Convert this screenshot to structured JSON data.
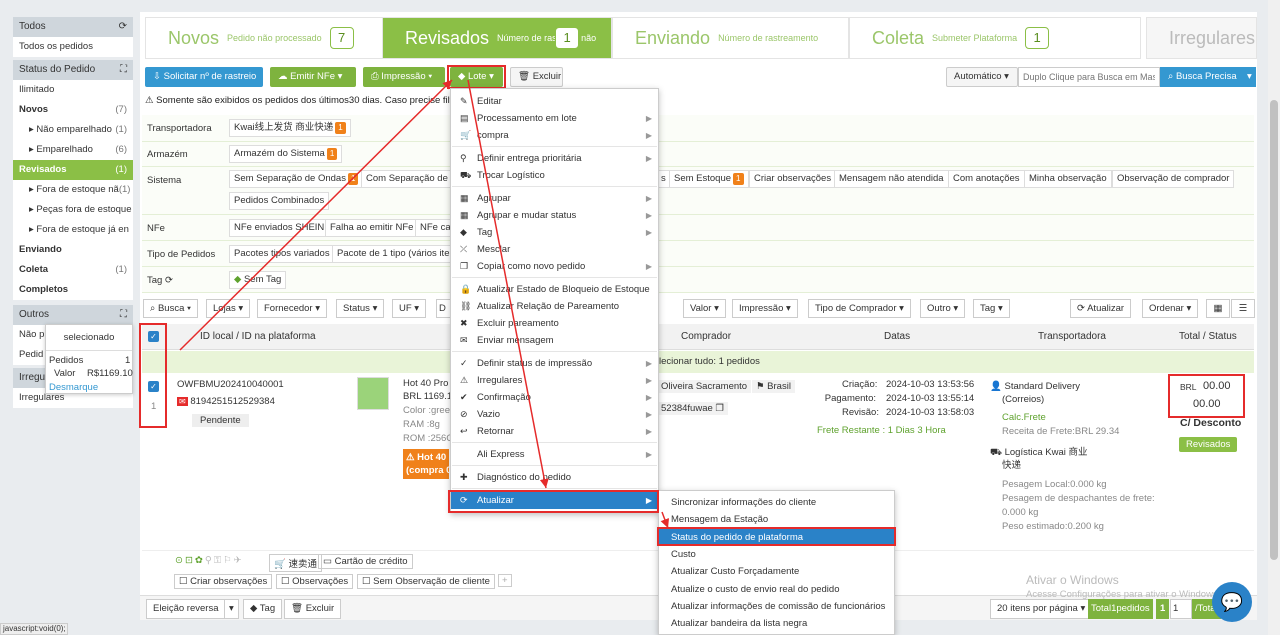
{
  "sidebar": {
    "todos_head": "Todos",
    "todos_item": "Todos os pedidos",
    "status_head": "Status do Pedido",
    "items": [
      {
        "label": "Ilimitado",
        "count": ""
      },
      {
        "label": "Novos",
        "count": "(7)"
      },
      {
        "label": "Não emparelhado",
        "count": "(1)"
      },
      {
        "label": "Emparelhado",
        "count": "(6)"
      },
      {
        "label": "Revisados",
        "count": "(1)"
      },
      {
        "label": "Fora de estoque nã",
        "count": "(1)"
      },
      {
        "label": "Peças fora de estoque",
        "count": ""
      },
      {
        "label": "Fora de estoque já en",
        "count": ""
      },
      {
        "label": "Enviando",
        "count": ""
      },
      {
        "label": "Coleta",
        "count": "(1)"
      },
      {
        "label": "Completos",
        "count": ""
      }
    ],
    "outros_head": "Outros",
    "outros_items": [
      "Não p",
      "Pedid"
    ],
    "irreg_head": "Irregu",
    "irreg_item": "Irregulares"
  },
  "popover": {
    "title": "selecionado",
    "pedidos_label": "Pedidos",
    "pedidos_val": "1",
    "valor_label": "Valor",
    "valor_val": "R$1169.10",
    "desmarque": "Desmarque"
  },
  "steps": [
    {
      "title": "Novos",
      "sub": "Pedido não processado",
      "count": "7"
    },
    {
      "title": "Revisados",
      "sub": "Número de rastre",
      "count": "1",
      "tail": "não"
    },
    {
      "title": "Enviando",
      "sub": "Número de rastreamento"
    },
    {
      "title": "Coleta",
      "sub": "Submeter Plataforma",
      "count": "1"
    },
    {
      "title": "Irregulares"
    }
  ],
  "toolbar": {
    "solicitar": "Solicitar nº de rastreio",
    "emitir": "Emitir NFe",
    "impressao": "Impressão",
    "lote": "Lote",
    "excluir": "Excluir",
    "automatico": "Automático",
    "search_placeholder": "Duplo Clique para Busca em Mass",
    "busca_precisa": "Busca Precisa"
  },
  "notice": "Somente são exibidos os pedidos dos últimos30 dias. Caso precise filtr",
  "filters": {
    "transportadora_label": "Transportadora",
    "transportadora_chip": "Kwai线上发货 商业快递",
    "transportadora_badge": "1",
    "armazem_label": "Armazém",
    "armazem_chip": "Armazém do Sistema",
    "armazem_badge": "1",
    "sistema_label": "Sistema",
    "sistema_chips": [
      "Sem Separação de Ondas",
      "Com Separação de O",
      "s",
      "Sem Estoque",
      "Criar observações",
      "Mensagem não atendida",
      "Com anotações",
      "Minha observação",
      "Observação de comprador",
      "Pedidos Combinados"
    ],
    "nfe_label": "NFe",
    "nfe_chips": [
      "NFe enviados SHEIN",
      "Falha ao emitir NFe",
      "NFe ca"
    ],
    "tipo_label": "Tipo de Pedidos",
    "tipo_chips": [
      "Pacotes tipos variados",
      "Pacote de 1 tipo (vários iten"
    ],
    "tag_label": "Tag",
    "tag_chip": "Sem Tag"
  },
  "filterbar": [
    "Busca",
    "Lojas",
    "Fornecedor",
    "Status",
    "UF",
    "D",
    "Valor",
    "Impressão",
    "Tipo de Comprador",
    "Outro",
    "Tag"
  ],
  "filterbar_right": {
    "atualizar": "Atualizar",
    "ordenar": "Ordenar"
  },
  "table": {
    "col_id": "ID local / ID na plataforma",
    "col_comprador": "Comprador",
    "col_datas": "Datas",
    "col_transp": "Transportadora",
    "col_total": "Total / Status",
    "select_all": "lecionar tudo: 1 pedidos"
  },
  "order": {
    "local_id": "OWFBMU202410040001",
    "platform_id": "8194251512529384",
    "index": "1",
    "status_tag": "Pendente",
    "product_title": "Hot 40 Pro",
    "product_price": "BRL 1169.1",
    "product_color": "Color :gree",
    "product_ram": "RAM :8g",
    "product_rom": "ROM :256G",
    "warn_line1": "Hot 40 I",
    "warn_line2": "(compra 0",
    "buyer_name": "Oliveira Sacramento",
    "buyer_country": "Brasil",
    "buyer_id": "52384fuwae",
    "criacao_label": "Criação:",
    "criacao_val": "2024-10-03 13:53:56",
    "pagamento_label": "Pagamento:",
    "pagamento_val": "2024-10-03 13:55:14",
    "revisao_label": "Revisão:",
    "revisao_val": "2024-10-03 13:58:03",
    "frete": "Frete Restante : 1 Dias 3 Hora",
    "transp_name": "Standard Delivery",
    "transp_sub": "(Correios)",
    "calc": "Calc.Frete",
    "receita": "Receita de Frete:BRL 29.34",
    "logistica": "Logística Kwai 商业",
    "logistica2": "快递",
    "peso_local": "Pesagem Local:0.000 kg",
    "peso_desp1": "Pesagem de despachantes de frete:",
    "peso_desp2": "0.000 kg",
    "peso_est": "Peso estimado:0.200 kg",
    "total_cur": "BRL",
    "total_val1": "00.00",
    "total_val2": "00.00",
    "desconto": "C/ Desconto",
    "status_btn": "Revisados",
    "channel": "速卖通",
    "cartao": "Cartão de crédito",
    "criar_obs": "Criar observações",
    "observacoes": "Observações",
    "sem_obs": "Sem Observação de cliente"
  },
  "menu": [
    {
      "icon": "edit-icon",
      "glyph": "✎",
      "label": "Editar",
      "arrow": false
    },
    {
      "icon": "batch-icon",
      "glyph": "▤",
      "label": "Processamento em lote",
      "arrow": true
    },
    {
      "icon": "cart-icon",
      "glyph": "🛒",
      "label": "compra",
      "arrow": true
    },
    {
      "icon": "pin-icon",
      "glyph": "⚲",
      "label": "Definir entrega prioritária",
      "arrow": true
    },
    {
      "icon": "truck-icon",
      "glyph": "⛟",
      "label": "Trocar Logístico",
      "arrow": false
    },
    {
      "icon": "group-icon",
      "glyph": "▦",
      "label": "Agrupar",
      "arrow": true
    },
    {
      "icon": "merge-group-icon",
      "glyph": "▦",
      "label": "Agrupar e mudar status",
      "arrow": true
    },
    {
      "icon": "tag-icon",
      "glyph": "◆",
      "label": "Tag",
      "arrow": true
    },
    {
      "icon": "merge-icon",
      "glyph": "⤫",
      "label": "Mesclar",
      "arrow": false
    },
    {
      "icon": "copy-icon",
      "glyph": "❐",
      "label": "Copiar como novo pedido",
      "arrow": true
    },
    {
      "icon": "lock-icon",
      "glyph": "🔒",
      "label": "Atualizar Estado de Bloqueio de Estoque",
      "arrow": false
    },
    {
      "icon": "link-icon",
      "glyph": "⛓",
      "label": "Atualizar Relação de Pareamento",
      "arrow": false
    },
    {
      "icon": "unlink-icon",
      "glyph": "✖",
      "label": "Excluir pareamento",
      "arrow": false
    },
    {
      "icon": "message-icon",
      "glyph": "✉",
      "label": "Enviar mensagem",
      "arrow": false
    },
    {
      "icon": "print-status-icon",
      "glyph": "✓",
      "label": "Definir status de impressão",
      "arrow": true
    },
    {
      "icon": "warning-icon",
      "glyph": "⚠",
      "label": "Irregulares",
      "arrow": true
    },
    {
      "icon": "confirm-icon",
      "glyph": "✔",
      "label": "Confirmação",
      "arrow": true
    },
    {
      "icon": "empty-icon",
      "glyph": "⊘",
      "label": "Vazio",
      "arrow": true
    },
    {
      "icon": "return-icon",
      "glyph": "↩",
      "label": "Retornar",
      "arrow": true
    },
    {
      "icon": "express-icon",
      "glyph": "",
      "label": "Ali Express",
      "arrow": true
    },
    {
      "icon": "diagnostic-icon",
      "glyph": "✚",
      "label": "Diagnóstico do pedido",
      "arrow": false
    },
    {
      "icon": "refresh-icon",
      "glyph": "⟳",
      "label": "Atualizar",
      "arrow": true
    }
  ],
  "submenu": [
    "Sincronizar informações do cliente",
    "Mensagem da Estação",
    "Status do pedido de plataforma",
    "Custo",
    "Atualizar Custo Forçadamente",
    "Atualize o custo de envio real do pedido",
    "Atualizar informações de comissão de funcionários",
    "Atualizar bandeira da lista negra"
  ],
  "bottom": {
    "eleicao": "Eleição reversa",
    "tag": "Tag",
    "excluir": "Excluir",
    "per_page": "20 itens por página",
    "total": "Total1pedidos",
    "page": "1",
    "page_input": "1",
    "total_pages": "/Total"
  },
  "watermark": {
    "line1": "Ativar o Windows",
    "line2": "Acesse Configurações para ativar o Windows."
  },
  "statusbar": "javascript:void(0);",
  "colors": {
    "accent_green": "#8bbf46",
    "accent_blue": "#3498d1",
    "highlight": "#2a82c8",
    "annotation_red": "#e52b2b"
  }
}
